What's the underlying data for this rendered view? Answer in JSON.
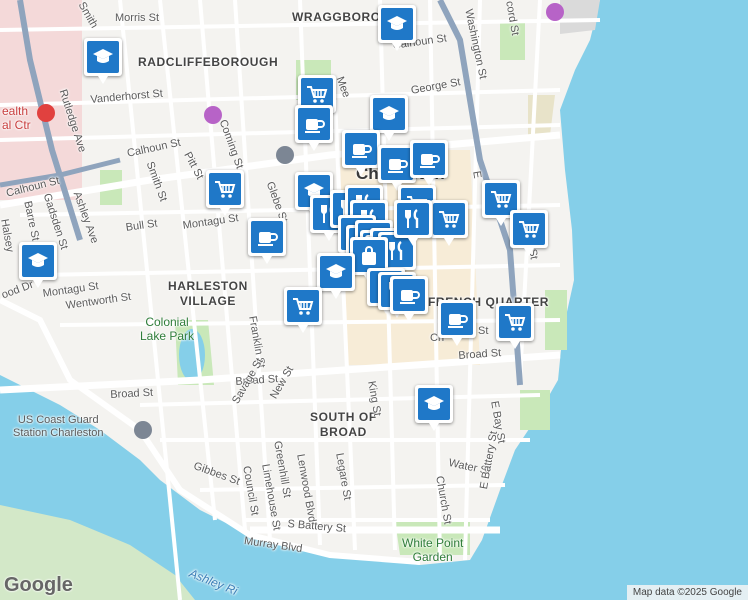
{
  "labels": {
    "neighborhoods": {
      "wraggborough": "WRAGGBOROUGH",
      "radcliffeborough": "RADCLIFFEBOROUGH",
      "harleston_village": "HARLESTON\nVILLAGE",
      "french_quarter": "FRENCH QUARTER",
      "south_of_broad": "SOUTH OF\nBROAD"
    },
    "city": "Charleston",
    "parks": {
      "colonial_lake": "Colonial\nLake Park",
      "white_point": "White Point\nGarden"
    },
    "pois": {
      "coast_guard": "US Coast Guard\nStation Charleston",
      "health": "ealth\nal Ctr"
    },
    "water": {
      "ashley_river": "Ashley Ri"
    },
    "streets": [
      {
        "key": "morris",
        "text": "Morris St"
      },
      {
        "key": "smith_n",
        "text": "Smith"
      },
      {
        "key": "calhoun_ne",
        "text": "Calhoun St"
      },
      {
        "key": "washington",
        "text": "Washington St"
      },
      {
        "key": "concord",
        "text": "cord St"
      },
      {
        "key": "rutledge",
        "text": "Rutledge Ave"
      },
      {
        "key": "vanderhorst",
        "text": "Vanderhorst St"
      },
      {
        "key": "george",
        "text": "George St"
      },
      {
        "key": "meeting",
        "text": "Mee"
      },
      {
        "key": "calhoun_w",
        "text": "Calhoun St"
      },
      {
        "key": "calhoun_far",
        "text": "Calhoun St"
      },
      {
        "key": "pitt",
        "text": "Pitt St"
      },
      {
        "key": "coming",
        "text": "Coming St"
      },
      {
        "key": "smith",
        "text": "Smith St"
      },
      {
        "key": "ashley_ave",
        "text": "Ashley Ave"
      },
      {
        "key": "gadsden",
        "text": "Gadsden St"
      },
      {
        "key": "barre",
        "text": "Barre St"
      },
      {
        "key": "halsey",
        "text": "Halsey"
      },
      {
        "key": "bull",
        "text": "Bull St"
      },
      {
        "key": "glebe",
        "text": "Glebe St"
      },
      {
        "key": "montagu_e",
        "text": "Montagu St"
      },
      {
        "key": "montagu_w",
        "text": "Montagu St"
      },
      {
        "key": "wentworth",
        "text": "Wentworth St"
      },
      {
        "key": "lockwood",
        "text": "ood Dr"
      },
      {
        "key": "franklin",
        "text": "Franklin St"
      },
      {
        "key": "broad_w",
        "text": "Broad St"
      },
      {
        "key": "broad_e",
        "text": "Broad St"
      },
      {
        "key": "broad_far",
        "text": "Broad St"
      },
      {
        "key": "chalmers",
        "text": "Ch"
      },
      {
        "key": "chalmers2",
        "text": "St"
      },
      {
        "key": "savage",
        "text": "Savage St"
      },
      {
        "key": "new",
        "text": "New St"
      },
      {
        "key": "king",
        "text": "King St"
      },
      {
        "key": "e_bay",
        "text": "E Bay St"
      },
      {
        "key": "greenhill",
        "text": "Greenhill St"
      },
      {
        "key": "lenwood",
        "text": "Lenwood Blvd"
      },
      {
        "key": "legare",
        "text": "Legare St"
      },
      {
        "key": "water",
        "text": "Water St"
      },
      {
        "key": "gibbes",
        "text": "Gibbes St"
      },
      {
        "key": "council",
        "text": "Council St"
      },
      {
        "key": "limehouse",
        "text": "Limehouse St"
      },
      {
        "key": "church",
        "text": "Church St"
      },
      {
        "key": "e_battery",
        "text": "E Battery St"
      },
      {
        "key": "s_battery",
        "text": "S Battery St"
      },
      {
        "key": "murray",
        "text": "Murray Blvd"
      },
      {
        "key": "east_st",
        "text": "E"
      },
      {
        "key": "east_st2",
        "text": "St"
      }
    ]
  },
  "pins": [
    {
      "type": "school",
      "name": "school-marker"
    },
    {
      "type": "school",
      "name": "school-marker"
    },
    {
      "type": "shopping",
      "name": "grocery-marker"
    },
    {
      "type": "cafe",
      "name": "cafe-marker"
    },
    {
      "type": "school",
      "name": "school-marker"
    },
    {
      "type": "cafe",
      "name": "cafe-marker"
    },
    {
      "type": "cafe",
      "name": "cafe-marker"
    },
    {
      "type": "cafe",
      "name": "cafe-marker"
    },
    {
      "type": "shopping",
      "name": "grocery-marker"
    },
    {
      "type": "school",
      "name": "school-marker"
    },
    {
      "type": "restaurant",
      "name": "restaurant-marker"
    },
    {
      "type": "restaurant",
      "name": "restaurant-marker"
    },
    {
      "type": "restaurant",
      "name": "restaurant-marker"
    },
    {
      "type": "restaurant",
      "name": "restaurant-marker"
    },
    {
      "type": "shopping",
      "name": "grocery-marker"
    },
    {
      "type": "shopping",
      "name": "grocery-marker"
    },
    {
      "type": "shopping",
      "name": "grocery-marker"
    },
    {
      "type": "shopping",
      "name": "grocery-marker"
    },
    {
      "type": "cafe",
      "name": "cafe-marker"
    },
    {
      "type": "restaurant",
      "name": "restaurant-marker"
    },
    {
      "type": "restaurant",
      "name": "restaurant-marker"
    },
    {
      "type": "restaurant",
      "name": "restaurant-marker"
    },
    {
      "type": "restaurant",
      "name": "restaurant-marker"
    },
    {
      "type": "restaurant",
      "name": "restaurant-marker"
    },
    {
      "type": "restaurant",
      "name": "restaurant-marker"
    },
    {
      "type": "restaurant",
      "name": "restaurant-marker"
    },
    {
      "type": "restaurant",
      "name": "restaurant-marker"
    },
    {
      "type": "shopping",
      "name": "bag-marker"
    },
    {
      "type": "school",
      "name": "school-marker"
    },
    {
      "type": "restaurant",
      "name": "restaurant-marker"
    },
    {
      "type": "restaurant",
      "name": "restaurant-marker"
    },
    {
      "type": "cafe",
      "name": "cafe-marker"
    },
    {
      "type": "shopping",
      "name": "grocery-marker"
    },
    {
      "type": "cafe",
      "name": "cafe-marker"
    },
    {
      "type": "shopping",
      "name": "grocery-marker"
    },
    {
      "type": "school",
      "name": "school-marker"
    },
    {
      "type": "school",
      "name": "school-marker"
    }
  ],
  "colors": {
    "pin_blue": "#1f78c8",
    "water": "#85cfe9",
    "park": "#c9e8b9",
    "land": "#f4f3f0",
    "beach": "#e8e3c9"
  },
  "footer": {
    "google": "Google",
    "attribution": "Map data ©2025 Google"
  }
}
